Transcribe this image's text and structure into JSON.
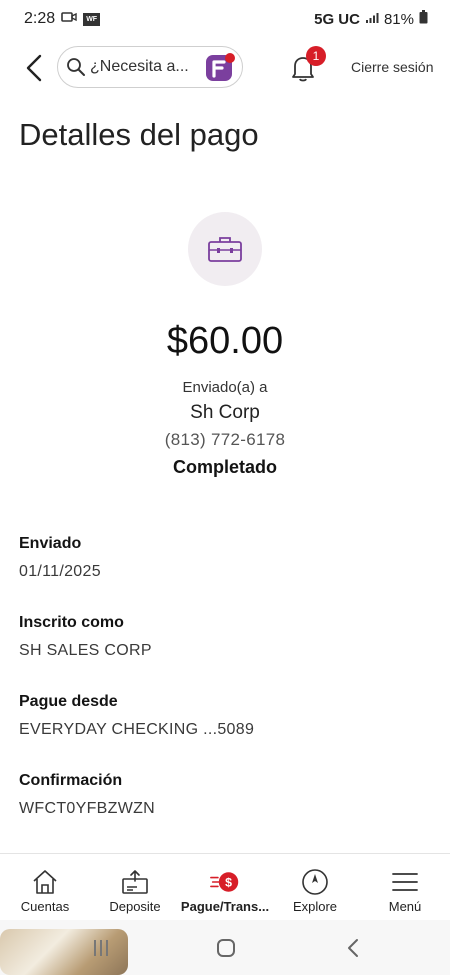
{
  "status_bar": {
    "time": "2:28",
    "network": "5G UC",
    "battery": "81%"
  },
  "header": {
    "search_placeholder": "¿Necesita a...",
    "notification_count": "1",
    "logout_label": "Cierre sesión"
  },
  "page": {
    "title": "Detalles del pago"
  },
  "payment": {
    "amount": "$60.00",
    "sent_to_label": "Enviado(a) a",
    "payee": "Sh Corp",
    "phone": "(813) 772-6178",
    "status": "Completado"
  },
  "details": [
    {
      "label": "Enviado",
      "value": "01/11/2025"
    },
    {
      "label": "Inscrito como",
      "value": "SH SALES CORP"
    },
    {
      "label": "Pague desde",
      "value": "EVERYDAY CHECKING ...5089"
    },
    {
      "label": "Confirmación",
      "value": "WFCT0YFBZWZN"
    }
  ],
  "bottom_nav": [
    {
      "label": "Cuentas",
      "icon": "home-icon"
    },
    {
      "label": "Deposite",
      "icon": "deposit-icon"
    },
    {
      "label": "Pague/Trans...",
      "icon": "pay-transfer-icon",
      "active": true
    },
    {
      "label": "Explore",
      "icon": "compass-icon"
    },
    {
      "label": "Menú",
      "icon": "hamburger-icon"
    }
  ],
  "colors": {
    "accent_red": "#d71e28",
    "purple": "#7b3f9e",
    "icon_circle": "#f1edf1"
  }
}
